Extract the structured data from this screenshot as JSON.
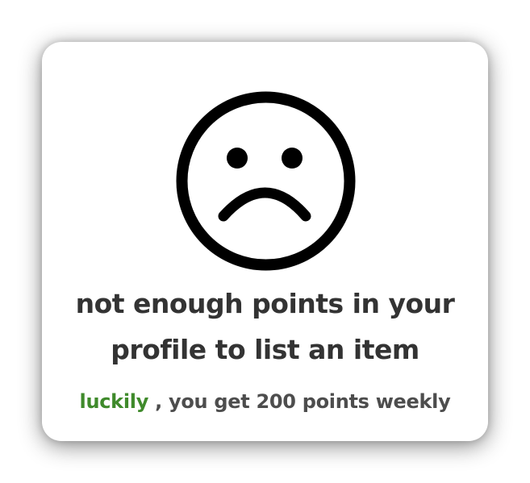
{
  "dialog": {
    "icon": "sad-face-icon",
    "message": "not enough points in your profile to list an item",
    "highlight_word": "luckily",
    "subtitle_rest": ", you get 200 points weekly"
  },
  "colors": {
    "text": "#333333",
    "subtext": "#4d4d4d",
    "highlight": "#3f8a2b",
    "icon": "#000000"
  }
}
